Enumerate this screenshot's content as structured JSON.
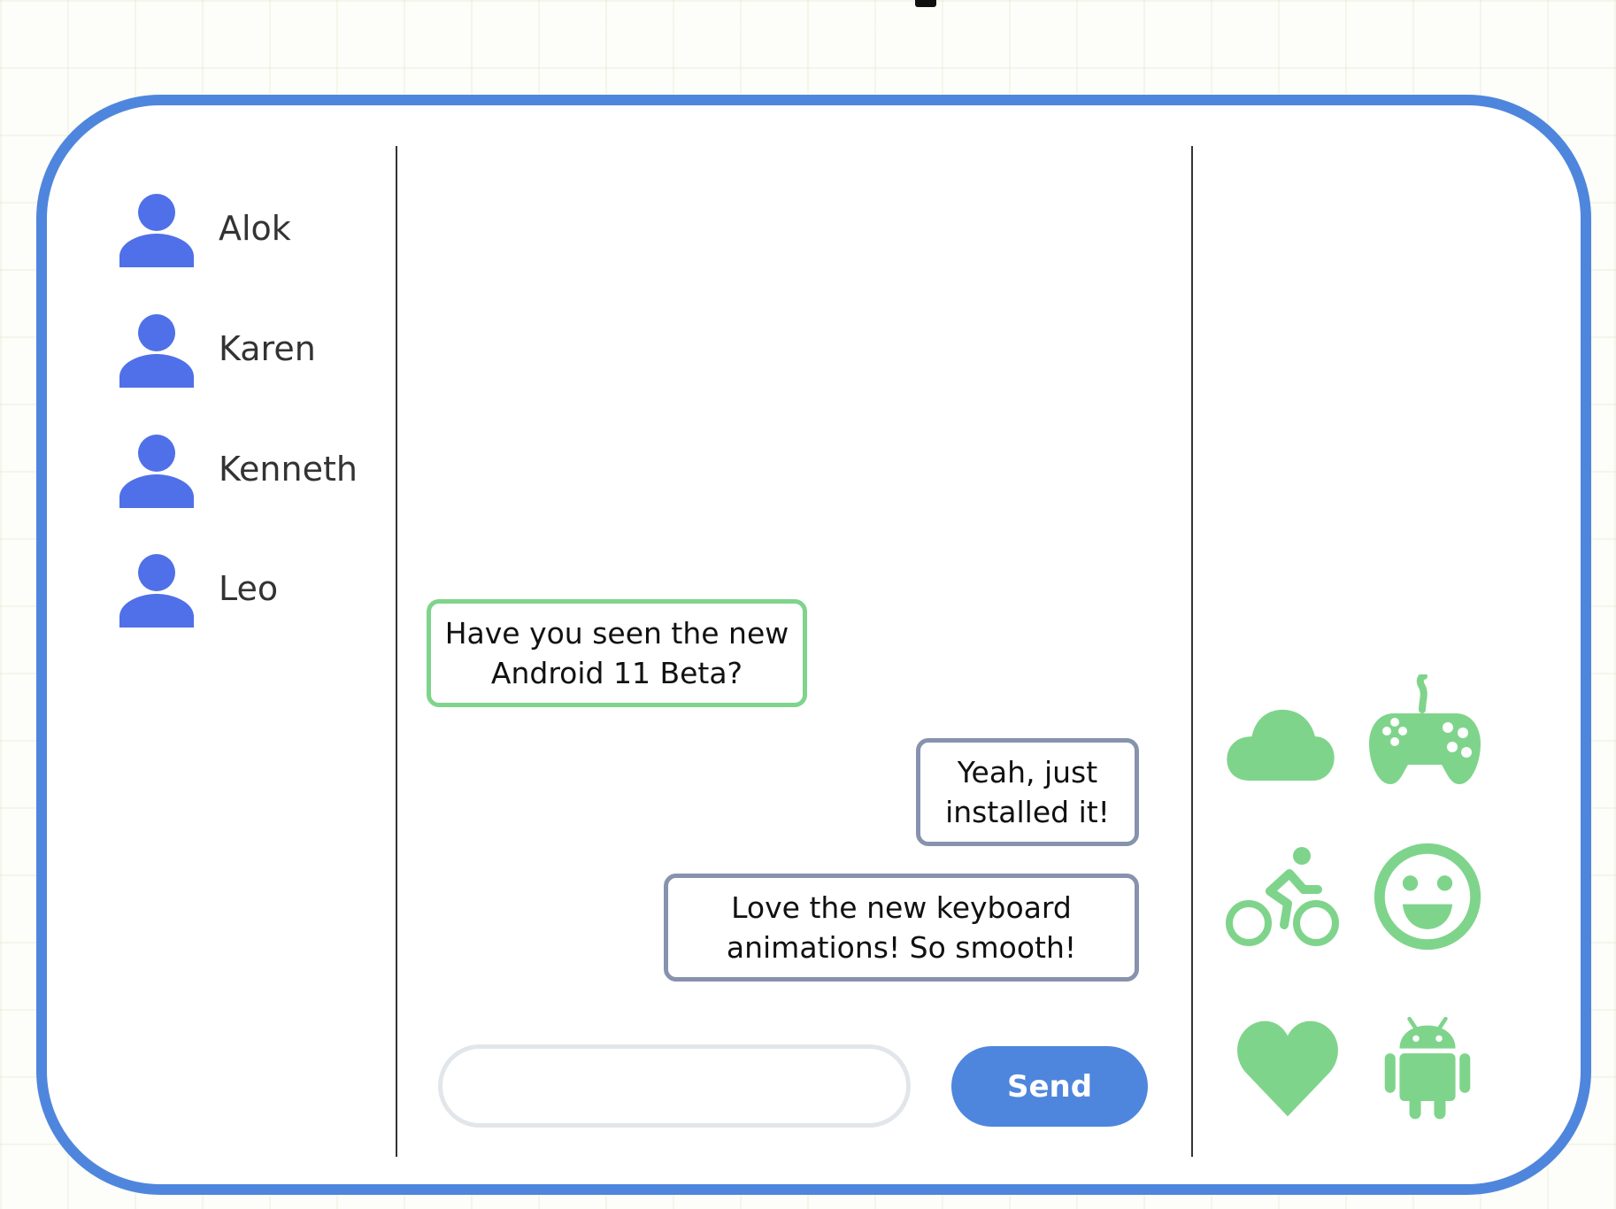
{
  "contacts": [
    {
      "name": "Alok",
      "icon": "person-icon"
    },
    {
      "name": "Karen",
      "icon": "person-icon"
    },
    {
      "name": "Kenneth",
      "icon": "person-icon"
    },
    {
      "name": "Leo",
      "icon": "person-icon"
    }
  ],
  "messages": [
    {
      "direction": "incoming",
      "lines": [
        "Have you seen the new",
        "Android 11 Beta?"
      ]
    },
    {
      "direction": "outgoing",
      "lines": [
        "Yeah, just",
        "installed it!"
      ]
    },
    {
      "direction": "outgoing",
      "lines": [
        "Love the new keyboard",
        "animations! So smooth!"
      ]
    }
  ],
  "composer": {
    "input_value": "",
    "send_label": "Send"
  },
  "stickers": [
    "cloud-icon",
    "gamepad-icon",
    "bike-icon",
    "smiley-icon",
    "heart-icon",
    "android-icon"
  ],
  "colors": {
    "frame": "#4f86dd",
    "avatar": "#4f70e8",
    "sticker": "#7fd48b",
    "incoming_border": "#7fd48b",
    "outgoing_border": "#8793ad",
    "send_button": "#4f86dd"
  }
}
